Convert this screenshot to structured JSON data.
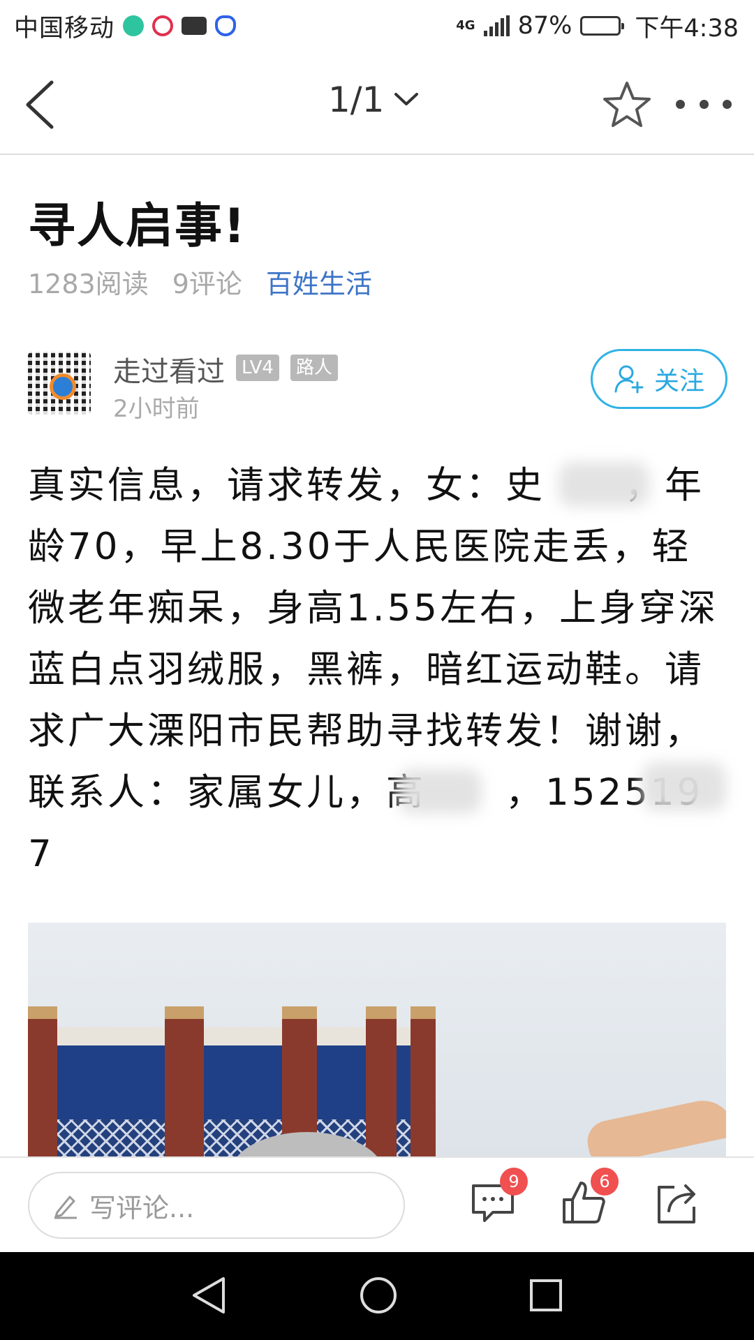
{
  "status_bar": {
    "carrier": "中国移动",
    "app_icons": [
      "meituan-icon",
      "video-icon",
      "briefcase-icon",
      "baidu-icon"
    ],
    "network": "4G",
    "battery_percent": "87%",
    "battery_level": 0.87,
    "time": "下午4:38"
  },
  "nav": {
    "page_indicator": "1/1"
  },
  "article": {
    "title": "寻人启事!",
    "reads": "1283阅读",
    "comments": "9评论",
    "category": "百姓生活",
    "author": {
      "name": "走过看过",
      "level_badge": "LV4",
      "role_badge": "路人",
      "time": "2小时前"
    },
    "follow_label": "关注",
    "body": "真实信息，请求转发，女：史　　，年龄70，早上8.30于人民医院走丢，轻微老年痴呆，身高1.55左右，上身穿深蓝白点羽绒服，黑裤，暗红运动鞋。请求广大溧阳市民帮助寻找转发！谢谢，联系人：家属女儿，高　　，152519　　　7"
  },
  "bottom_bar": {
    "comment_placeholder": "写评论...",
    "comment_count": "9",
    "like_count": "6"
  },
  "colors": {
    "accent_blue": "#2fb2e6",
    "category_blue": "#3d74c7",
    "badge_red": "#f05050",
    "badge_gray": "#b8b8b8"
  }
}
